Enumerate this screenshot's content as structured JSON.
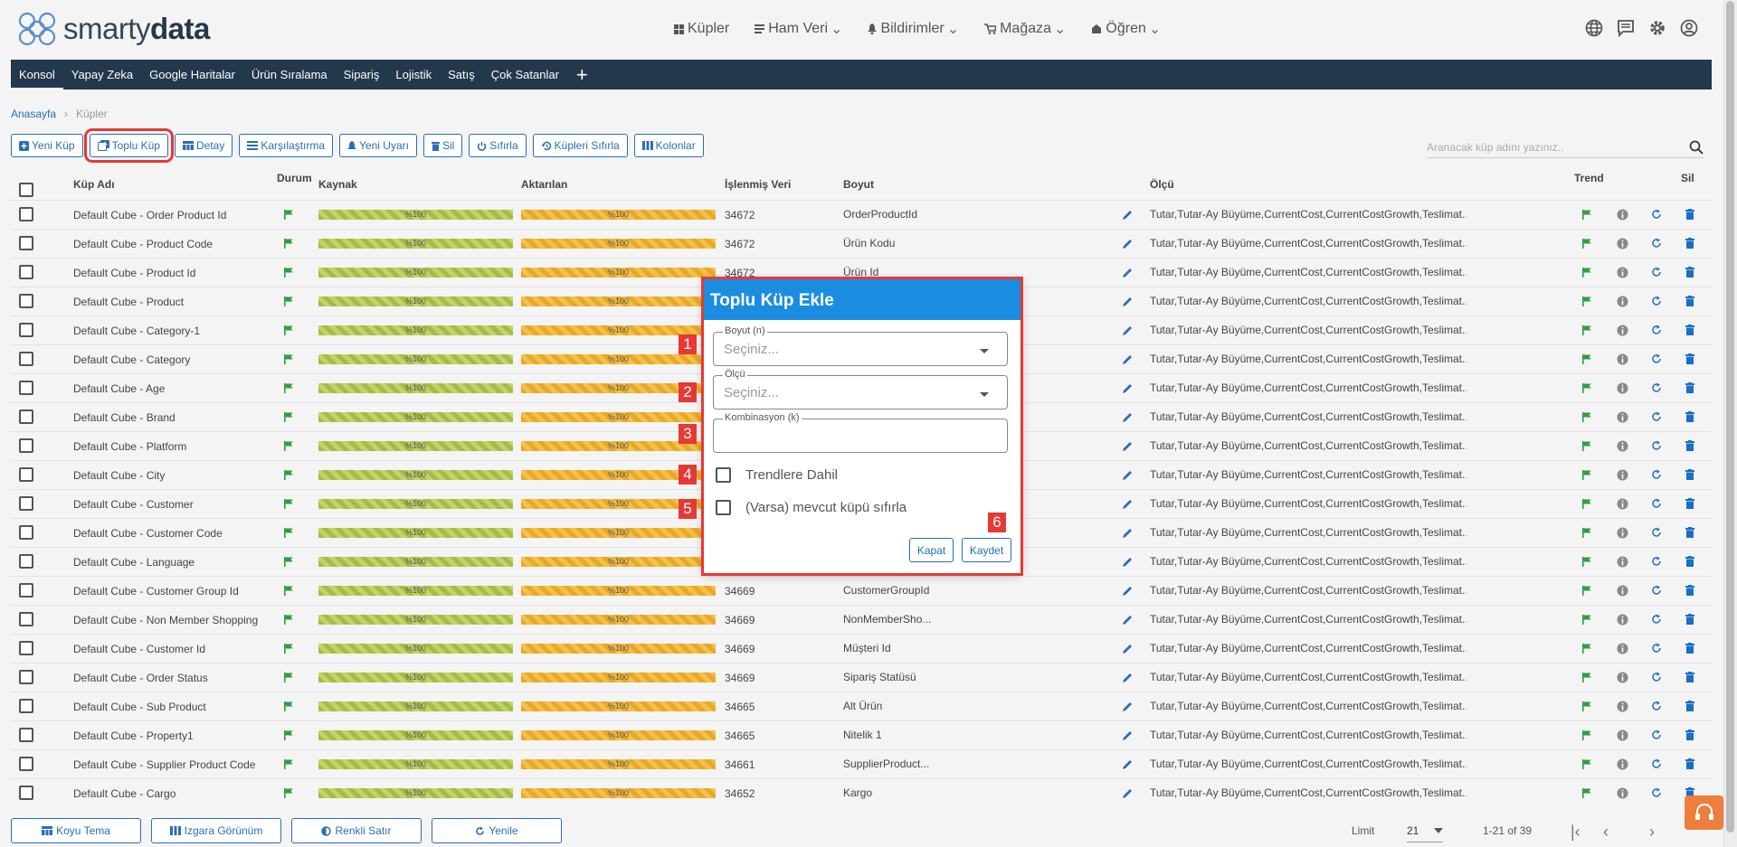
{
  "logo": {
    "part1": "smarty",
    "part2": "data"
  },
  "top_menu": [
    {
      "label": "Küpler",
      "icon": "grid-icon",
      "dropdown": false
    },
    {
      "label": "Ham Veri",
      "icon": "list-icon",
      "dropdown": true
    },
    {
      "label": "Bildirimler",
      "icon": "bell-icon",
      "dropdown": true
    },
    {
      "label": "Mağaza",
      "icon": "cart-icon",
      "dropdown": true
    },
    {
      "label": "Öğren",
      "icon": "learn-icon",
      "dropdown": true
    }
  ],
  "nav_tabs": [
    "Konsol",
    "Yapay Zeka",
    "Google Haritalar",
    "Ürün Sıralama",
    "Sipariş",
    "Lojistik",
    "Satış",
    "Çok Satanlar"
  ],
  "breadcrumb": {
    "home": "Anasayfa",
    "current": "Küpler"
  },
  "toolbar": [
    "Yeni Küp",
    "Toplu Küp",
    "Detay",
    "Karşılaştırma",
    "Yeni Uyarı",
    "Sil",
    "Sıfırla",
    "Küpleri Sıfırla",
    "Kolonlar"
  ],
  "search_placeholder": "Aranacak küp adını yazınız..",
  "columns": {
    "name": "Küp Adı",
    "status": "Durum",
    "source": "Kaynak",
    "transferred": "Aktarılan",
    "processed": "İşlenmiş Veri",
    "dimension": "Boyut",
    "measure": "Ölçü",
    "trend": "Trend",
    "delete": "Sil"
  },
  "progress_label": "%100",
  "progress_value": 1.0,
  "measure_text": "Tutar,Tutar-Ay Büyüme,CurrentCost,CurrentCostGrowth,Teslimat...",
  "rows": [
    {
      "name": "Default Cube - Order Product Id",
      "processed": "34672",
      "dimension": "OrderProductId"
    },
    {
      "name": "Default Cube - Product Code",
      "processed": "34672",
      "dimension": "Ürün Kodu"
    },
    {
      "name": "Default Cube - Product Id",
      "processed": "34672",
      "dimension": "Ürün Id"
    },
    {
      "name": "Default Cube - Product",
      "processed": "",
      "dimension": ""
    },
    {
      "name": "Default Cube - Category-1",
      "processed": "",
      "dimension": ""
    },
    {
      "name": "Default Cube - Category",
      "processed": "",
      "dimension": ""
    },
    {
      "name": "Default Cube - Age",
      "processed": "",
      "dimension": ""
    },
    {
      "name": "Default Cube - Brand",
      "processed": "",
      "dimension": ""
    },
    {
      "name": "Default Cube - Platform",
      "processed": "",
      "dimension": ""
    },
    {
      "name": "Default Cube - City",
      "processed": "",
      "dimension": ""
    },
    {
      "name": "Default Cube - Customer",
      "processed": "",
      "dimension": ""
    },
    {
      "name": "Default Cube - Customer Code",
      "processed": "",
      "dimension": ""
    },
    {
      "name": "Default Cube - Language",
      "processed": "",
      "dimension": ""
    },
    {
      "name": "Default Cube - Customer Group Id",
      "processed": "34669",
      "dimension": "CustomerGroupId"
    },
    {
      "name": "Default Cube - Non Member Shopping",
      "processed": "34669",
      "dimension": "NonMemberSho..."
    },
    {
      "name": "Default Cube - Customer Id",
      "processed": "34669",
      "dimension": "Müşteri Id"
    },
    {
      "name": "Default Cube - Order Status",
      "processed": "34669",
      "dimension": "Sipariş Statüsü"
    },
    {
      "name": "Default Cube - Sub Product",
      "processed": "34665",
      "dimension": "Alt Ürün"
    },
    {
      "name": "Default Cube - Property1",
      "processed": "34665",
      "dimension": "Nitelik 1"
    },
    {
      "name": "Default Cube - Supplier Product Code",
      "processed": "34661",
      "dimension": "SupplierProduct..."
    },
    {
      "name": "Default Cube - Cargo",
      "processed": "34652",
      "dimension": "Kargo"
    }
  ],
  "footer_buttons": [
    "Koyu Tema",
    "Izgara Görünüm",
    "Renkli Satır",
    "Yenile"
  ],
  "pagination": {
    "limit_label": "Limit",
    "limit_value": "21",
    "range": "1-21 of 39"
  },
  "modal": {
    "title": "Toplu Küp Ekle",
    "dimension_label": "Boyut (n)",
    "dimension_placeholder": "Seçiniz...",
    "measure_label": "Ölçü",
    "measure_placeholder": "Seçiniz...",
    "combination_label": "Kombinasyon (k)",
    "combination_value": "",
    "include_trends": "Trendlere Dahil",
    "reset_existing": "(Varsa) mevcut küpü sıfırla",
    "close": "Kapat",
    "save": "Kaydet",
    "markers": [
      "1",
      "2",
      "3",
      "4",
      "5",
      "6"
    ]
  },
  "colors": {
    "nav_bg": "#23374d",
    "accent": "#1a8de1",
    "highlight": "#e53935",
    "green": "#2e9e3e",
    "source_bar": "#a4bd45",
    "transferred_bar": "#e9a825"
  }
}
